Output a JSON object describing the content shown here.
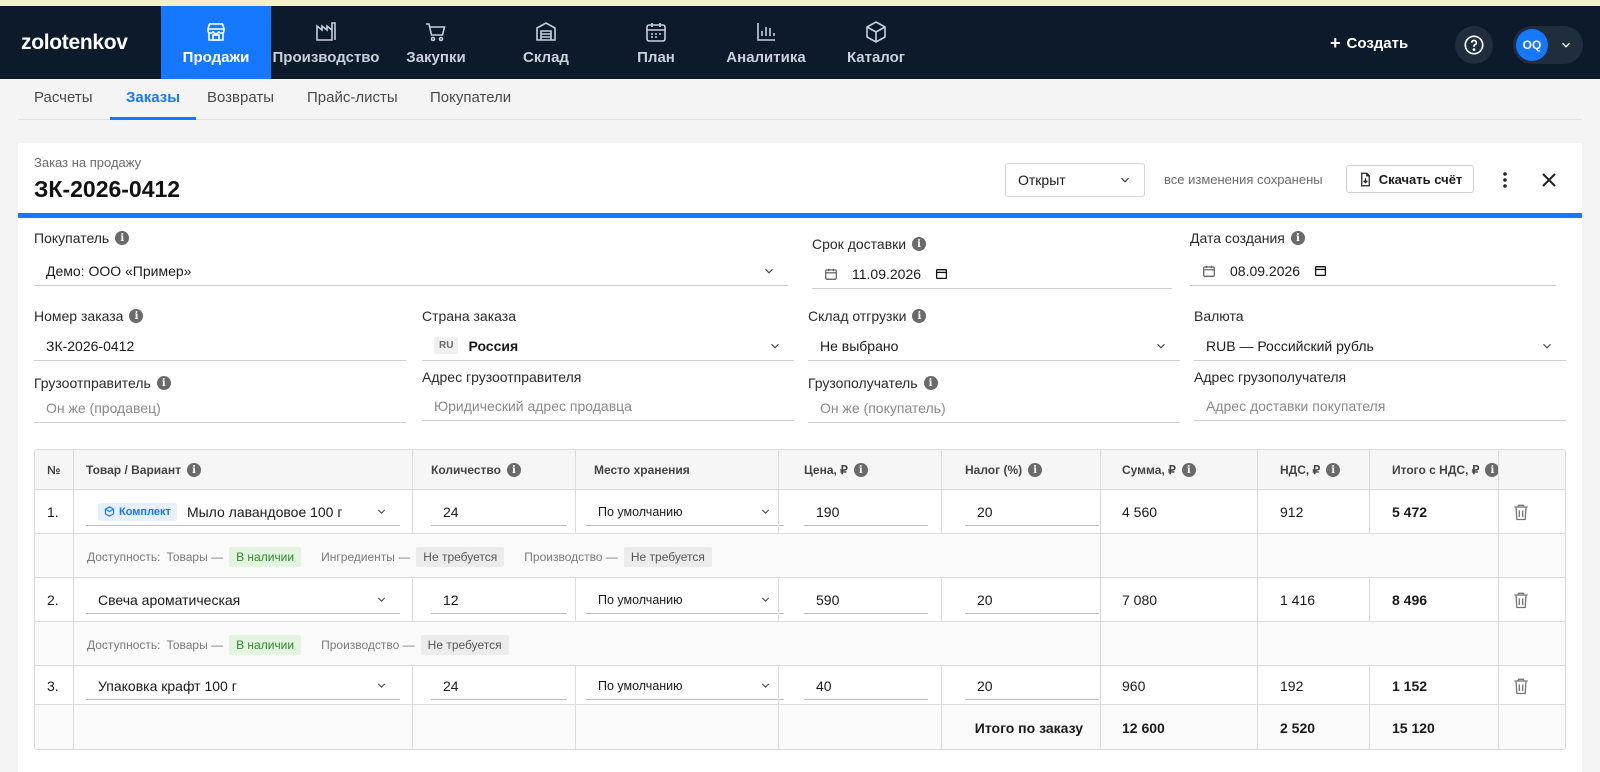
{
  "brand": "zolotenkov",
  "nav": [
    {
      "label": "Продажи",
      "icon": "store-icon",
      "active": true
    },
    {
      "label": "Производство",
      "icon": "factory-icon"
    },
    {
      "label": "Закупки",
      "icon": "cart-icon"
    },
    {
      "label": "Склад",
      "icon": "warehouse-icon"
    },
    {
      "label": "План",
      "icon": "calendar-icon"
    },
    {
      "label": "Аналитика",
      "icon": "bar-chart-icon"
    },
    {
      "label": "Каталог",
      "icon": "box-icon"
    }
  ],
  "header": {
    "create_label": "Создать",
    "avatar_initials": "OQ"
  },
  "subtabs": [
    "Расчеты",
    "Заказы",
    "Возвраты",
    "Прайс-листы",
    "Покупатели"
  ],
  "doc": {
    "kind": "Заказ на продажу",
    "number": "ЗК-2026-0412",
    "status": "Открыт",
    "saved_note": "все изменения сохранены",
    "download_label": "Скачать счёт"
  },
  "form": {
    "buyer": {
      "label": "Покупатель",
      "value": "Демо: ООО «Пример»"
    },
    "delivery_date": {
      "label": "Срок доставки",
      "value": "11.09.2026"
    },
    "created_date": {
      "label": "Дата создания",
      "value": "08.09.2026"
    },
    "order_number": {
      "label": "Номер заказа",
      "value": "ЗК-2026-0412"
    },
    "country": {
      "label": "Страна заказа",
      "code": "RU",
      "value": "Россия"
    },
    "warehouse": {
      "label": "Склад отгрузки",
      "value": "Не выбрано"
    },
    "currency": {
      "label": "Валюта",
      "value": "RUB — Российский рубль"
    },
    "shipper": {
      "label": "Грузоотправитель",
      "placeholder": "Он же (продавец)"
    },
    "shipper_address": {
      "label": "Адрес грузоотправителя",
      "placeholder": "Юридический адрес продавца"
    },
    "consignee": {
      "label": "Грузополучатель",
      "placeholder": "Он же (покупатель)"
    },
    "consignee_address": {
      "label": "Адрес грузополучателя",
      "placeholder": "Адрес доставки покупателя"
    }
  },
  "table": {
    "headers": [
      "№",
      "Товар / Вариант",
      "Количество",
      "Место хранения",
      "Цена, ₽",
      "Налог (%)",
      "Сумма, ₽",
      "НДС, ₽",
      "Итого с НДС, ₽"
    ],
    "rows": [
      {
        "n": "1.",
        "badge": "Комплект",
        "product": "Мыло лавандовое 100 г",
        "qty": "24",
        "storage": "По умолчанию",
        "price": "190",
        "tax": "20",
        "sum": "4 560",
        "vat": "912",
        "total": "5 472"
      },
      {
        "n": "2.",
        "product": "Свеча ароматическая",
        "qty": "12",
        "storage": "По умолчанию",
        "price": "590",
        "tax": "20",
        "sum": "7 080",
        "vat": "1 416",
        "total": "8 496"
      },
      {
        "n": "3.",
        "product": "Упаковка крафт 100 г",
        "qty": "24",
        "storage": "По умолчанию",
        "price": "40",
        "tax": "20",
        "sum": "960",
        "vat": "192",
        "total": "1 152"
      }
    ],
    "availability": {
      "prefix": "Доступность:",
      "goods": "Товары —",
      "in_stock": "В наличии",
      "ingredients": "Ингредиенты —",
      "production": "Производство —",
      "not_required": "Не требуется"
    },
    "totals": {
      "label": "Итого по заказу",
      "sum": "12 600",
      "vat": "2 520",
      "total": "15 120"
    }
  },
  "colors": {
    "accent": "#1677ff",
    "topbar": "#0c1a2b",
    "in_stock": "#2b8a2b"
  }
}
